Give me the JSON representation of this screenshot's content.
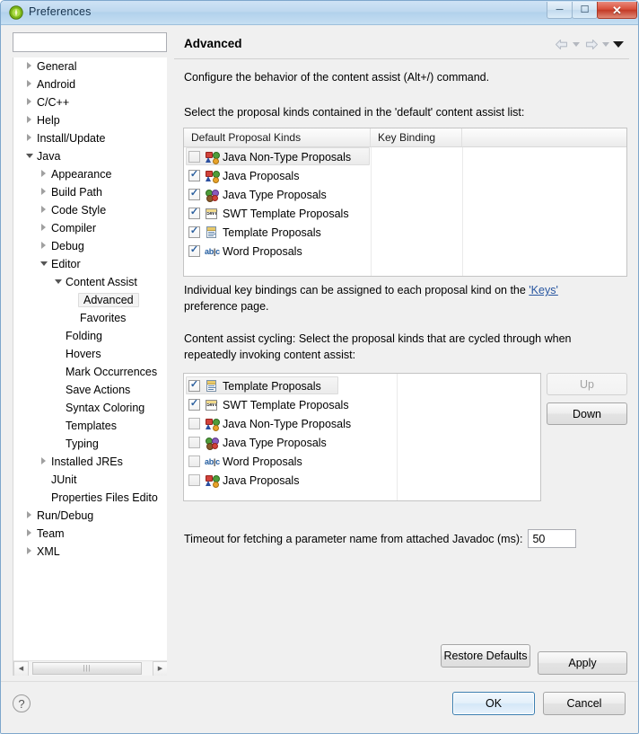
{
  "window": {
    "title": "Preferences",
    "icon": "eclipse-logo-icon",
    "buttons": {
      "minimize": "–",
      "maximize": "❐",
      "close": "✕"
    }
  },
  "search": {
    "value": "",
    "placeholder": ""
  },
  "tree": {
    "items": [
      {
        "label": "General",
        "indent": 0,
        "expander": "collapsed",
        "selected": false
      },
      {
        "label": "Android",
        "indent": 0,
        "expander": "collapsed",
        "selected": false
      },
      {
        "label": "C/C++",
        "indent": 0,
        "expander": "collapsed",
        "selected": false
      },
      {
        "label": "Help",
        "indent": 0,
        "expander": "collapsed",
        "selected": false
      },
      {
        "label": "Install/Update",
        "indent": 0,
        "expander": "collapsed",
        "selected": false
      },
      {
        "label": "Java",
        "indent": 0,
        "expander": "expanded",
        "selected": false
      },
      {
        "label": "Appearance",
        "indent": 1,
        "expander": "collapsed",
        "selected": false
      },
      {
        "label": "Build Path",
        "indent": 1,
        "expander": "collapsed",
        "selected": false
      },
      {
        "label": "Code Style",
        "indent": 1,
        "expander": "collapsed",
        "selected": false
      },
      {
        "label": "Compiler",
        "indent": 1,
        "expander": "collapsed",
        "selected": false
      },
      {
        "label": "Debug",
        "indent": 1,
        "expander": "collapsed",
        "selected": false
      },
      {
        "label": "Editor",
        "indent": 1,
        "expander": "expanded",
        "selected": false
      },
      {
        "label": "Content Assist",
        "indent": 2,
        "expander": "expanded",
        "selected": false
      },
      {
        "label": "Advanced",
        "indent": 3,
        "expander": "none",
        "selected": true
      },
      {
        "label": "Favorites",
        "indent": 3,
        "expander": "none",
        "selected": false
      },
      {
        "label": "Folding",
        "indent": 2,
        "expander": "none",
        "selected": false
      },
      {
        "label": "Hovers",
        "indent": 2,
        "expander": "none",
        "selected": false
      },
      {
        "label": "Mark Occurrences",
        "indent": 2,
        "expander": "none",
        "selected": false
      },
      {
        "label": "Save Actions",
        "indent": 2,
        "expander": "none",
        "selected": false
      },
      {
        "label": "Syntax Coloring",
        "indent": 2,
        "expander": "none",
        "selected": false
      },
      {
        "label": "Templates",
        "indent": 2,
        "expander": "none",
        "selected": false
      },
      {
        "label": "Typing",
        "indent": 2,
        "expander": "none",
        "selected": false
      },
      {
        "label": "Installed JREs",
        "indent": 1,
        "expander": "collapsed",
        "selected": false
      },
      {
        "label": "JUnit",
        "indent": 1,
        "expander": "none",
        "selected": false
      },
      {
        "label": "Properties Files Edito",
        "indent": 1,
        "expander": "none",
        "selected": false
      },
      {
        "label": "Run/Debug",
        "indent": 0,
        "expander": "collapsed",
        "selected": false
      },
      {
        "label": "Team",
        "indent": 0,
        "expander": "collapsed",
        "selected": false
      },
      {
        "label": "XML",
        "indent": 0,
        "expander": "collapsed",
        "selected": false
      }
    ],
    "scrollbar": {
      "left_arrow": "◀",
      "right_arrow": "▶",
      "grip": "|||"
    }
  },
  "pane": {
    "title": "Advanced",
    "nav": {
      "back": "back-arrow-icon",
      "back_menu": "chevron-down-icon",
      "forward": "forward-arrow-icon",
      "forward_menu": "chevron-down-icon",
      "view_menu": "chevron-down-icon"
    },
    "description": "Configure the behavior of the content assist (Alt+/) command.",
    "default_list_label": "Select the proposal kinds contained in the 'default' content assist list:",
    "keys_note": {
      "before": "Individual key bindings can be assigned to each proposal kind on the ",
      "link": "'Keys'",
      "after": " preference page."
    },
    "cycling_label": "Content assist cycling: Select the proposal kinds that are cycled through when repeatedly invoking content assist:"
  },
  "default_table": {
    "columns": [
      "Default Proposal Kinds",
      "Key Binding",
      ""
    ],
    "rows": [
      {
        "label": "Java Non-Type Proposals",
        "checked": false,
        "selected": true,
        "icon": "java-nontype-proposals-icon",
        "key_binding": ""
      },
      {
        "label": "Java Proposals",
        "checked": true,
        "selected": false,
        "icon": "java-proposals-icon",
        "key_binding": ""
      },
      {
        "label": "Java Type Proposals",
        "checked": true,
        "selected": false,
        "icon": "java-type-proposals-icon",
        "key_binding": ""
      },
      {
        "label": "SWT Template Proposals",
        "checked": true,
        "selected": false,
        "icon": "swt-template-proposals-icon",
        "key_binding": ""
      },
      {
        "label": "Template Proposals",
        "checked": true,
        "selected": false,
        "icon": "template-proposals-icon",
        "key_binding": ""
      },
      {
        "label": "Word Proposals",
        "checked": true,
        "selected": false,
        "icon": "word-proposals-icon",
        "key_binding": ""
      }
    ]
  },
  "cycling_table": {
    "rows": [
      {
        "label": "Template Proposals",
        "checked": true,
        "selected": true,
        "icon": "template-proposals-icon"
      },
      {
        "label": "SWT Template Proposals",
        "checked": true,
        "selected": false,
        "icon": "swt-template-proposals-icon"
      },
      {
        "label": "Java Non-Type Proposals",
        "checked": false,
        "selected": false,
        "icon": "java-nontype-proposals-icon"
      },
      {
        "label": "Java Type Proposals",
        "checked": false,
        "selected": false,
        "icon": "java-type-proposals-icon"
      },
      {
        "label": "Word Proposals",
        "checked": false,
        "selected": false,
        "icon": "word-proposals-icon"
      },
      {
        "label": "Java Proposals",
        "checked": false,
        "selected": false,
        "icon": "java-proposals-icon"
      }
    ],
    "up_button": "Up",
    "up_enabled": false,
    "down_button": "Down",
    "down_enabled": true
  },
  "timeout": {
    "label": "Timeout for fetching a parameter name from attached Javadoc (ms):",
    "value": "50"
  },
  "page_buttons": {
    "restore_defaults": "Restore Defaults",
    "apply": "Apply"
  },
  "footer": {
    "help": "?",
    "ok": "OK",
    "cancel": "Cancel"
  },
  "colors": {
    "titlebar": "#bed8ef",
    "close_button": "#d9503c",
    "link": "#2856a0",
    "ok_focus_border": "#3c7fb1",
    "checkbox_tick": "#2b5f9e"
  }
}
